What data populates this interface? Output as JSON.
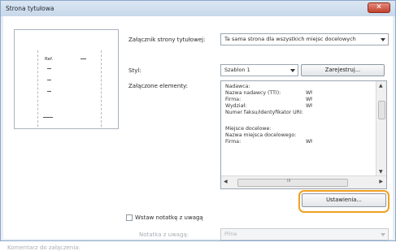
{
  "window": {
    "title": "Strona tytułowa"
  },
  "preview": {
    "ref_label": "Ref."
  },
  "attachment": {
    "label": "Załącznik strony tytułowej:",
    "value": "Ta sama strona dla wszystkich miejsc docelowych"
  },
  "style": {
    "label": "Styl:",
    "value": "Szablon 1",
    "register_button": "Zarejestruj..."
  },
  "included_items": {
    "label": "Załączone elementy:",
    "rows": [
      {
        "name": "Nadawca:",
        "value": ""
      },
      {
        "name": "Nazwa nadawcy (TTI):",
        "value": "Wł"
      },
      {
        "name": "Firma:",
        "value": "Wł"
      },
      {
        "name": "Wydział:",
        "value": "Wł"
      },
      {
        "name": "Numer faksu/Identyfikator URI:",
        "value": ""
      },
      {
        "name": "",
        "value": ""
      },
      {
        "name": "Miejsce docelowe:",
        "value": ""
      },
      {
        "name": "Nazwa miejsca docelowego:",
        "value": ""
      },
      {
        "name": "Firma:",
        "value": "Wł"
      }
    ],
    "hscroll_mark": "III"
  },
  "settings_button": "Ustawienia...",
  "note": {
    "checkbox_label": "Wstaw notatkę z uwagą",
    "type_label": "Notatka z uwagą:",
    "type_value": "Pilne"
  },
  "comment_label": "Komentarz do załączenia:"
}
